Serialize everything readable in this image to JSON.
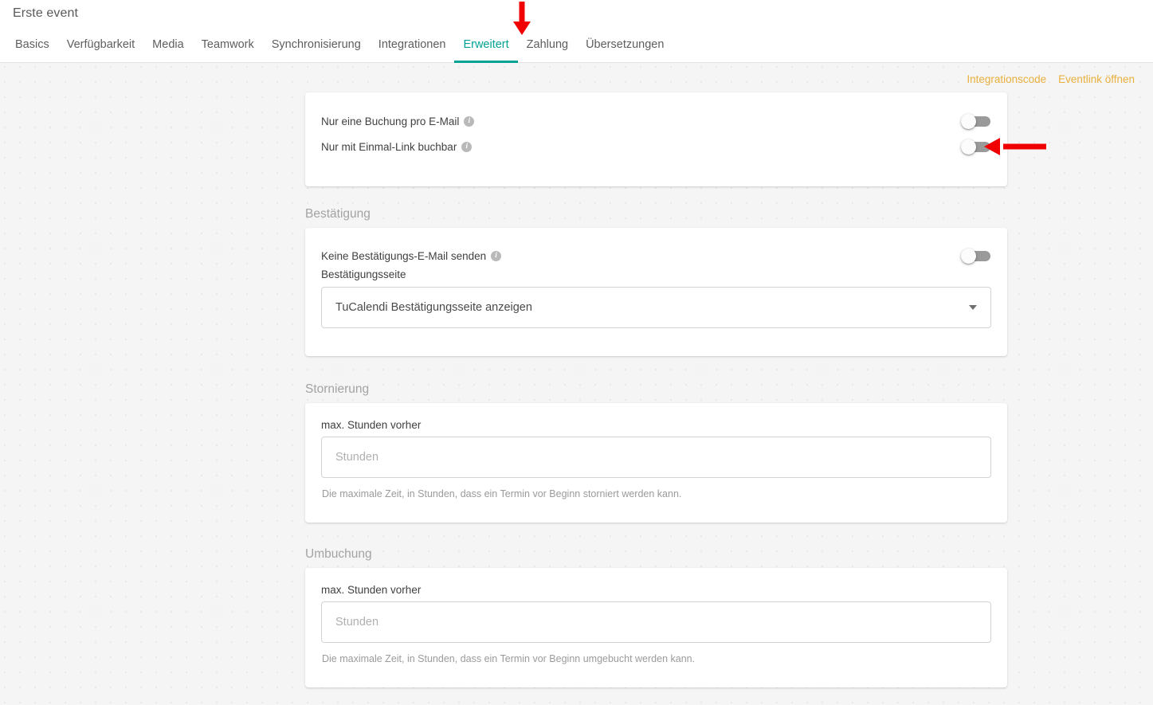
{
  "header": {
    "title": "Erste event",
    "tabs": [
      {
        "label": "Basics",
        "active": false
      },
      {
        "label": "Verfügbarkeit",
        "active": false
      },
      {
        "label": "Media",
        "active": false
      },
      {
        "label": "Teamwork",
        "active": false
      },
      {
        "label": "Synchronisierung",
        "active": false
      },
      {
        "label": "Integrationen",
        "active": false
      },
      {
        "label": "Erweitert",
        "active": true
      },
      {
        "label": "Zahlung",
        "active": false
      },
      {
        "label": "Übersetzungen",
        "active": false
      }
    ],
    "active_tab": "Erweitert",
    "accent_color": "#00a294"
  },
  "toplinks": {
    "integrationscode": "Integrationscode",
    "eventlink": "Eventlink öffnen",
    "color": "#e9b03e"
  },
  "booking_card": {
    "rows": [
      {
        "label": "Nur eine Buchung pro E-Mail",
        "info": "i",
        "toggle": "off"
      },
      {
        "label": "Nur mit Einmal-Link buchbar",
        "info": "i",
        "toggle": "off"
      }
    ]
  },
  "confirmation": {
    "heading": "Bestätigung",
    "toggle_row": {
      "label": "Keine Bestätigungs-E-Mail senden",
      "info": "i",
      "toggle": "off"
    },
    "select_label": "Bestätigungsseite",
    "select_value": "TuCalendi Bestätigungsseite anzeigen"
  },
  "cancellation": {
    "heading": "Stornierung",
    "field_label": "max. Stunden vorher",
    "placeholder": "Stunden",
    "value": "",
    "helper": "Die maximale Zeit, in Stunden, dass ein Termin vor Beginn storniert werden kann."
  },
  "rebooking": {
    "heading": "Umbuchung",
    "field_label": "max. Stunden vorher",
    "placeholder": "Stunden",
    "value": "",
    "helper": "Die maximale Zeit, in Stunden, dass ein Termin vor Beginn umgebucht werden kann."
  },
  "annotations": {
    "arrow_color": "#f00000",
    "down_arrow_target": "Erweitert",
    "left_arrow_target": "Nur mit Einmal-Link buchbar"
  }
}
